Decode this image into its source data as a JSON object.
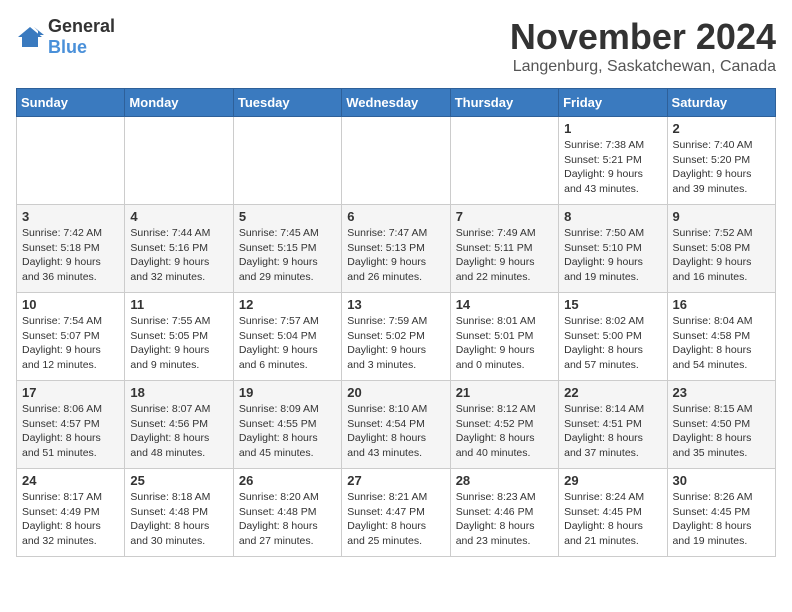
{
  "logo": {
    "general": "General",
    "blue": "Blue"
  },
  "title": "November 2024",
  "location": "Langenburg, Saskatchewan, Canada",
  "days_of_week": [
    "Sunday",
    "Monday",
    "Tuesday",
    "Wednesday",
    "Thursday",
    "Friday",
    "Saturday"
  ],
  "weeks": [
    [
      {
        "day": "",
        "sunrise": "",
        "sunset": "",
        "daylight": ""
      },
      {
        "day": "",
        "sunrise": "",
        "sunset": "",
        "daylight": ""
      },
      {
        "day": "",
        "sunrise": "",
        "sunset": "",
        "daylight": ""
      },
      {
        "day": "",
        "sunrise": "",
        "sunset": "",
        "daylight": ""
      },
      {
        "day": "",
        "sunrise": "",
        "sunset": "",
        "daylight": ""
      },
      {
        "day": "1",
        "sunrise": "Sunrise: 7:38 AM",
        "sunset": "Sunset: 5:21 PM",
        "daylight": "Daylight: 9 hours and 43 minutes."
      },
      {
        "day": "2",
        "sunrise": "Sunrise: 7:40 AM",
        "sunset": "Sunset: 5:20 PM",
        "daylight": "Daylight: 9 hours and 39 minutes."
      }
    ],
    [
      {
        "day": "3",
        "sunrise": "Sunrise: 7:42 AM",
        "sunset": "Sunset: 5:18 PM",
        "daylight": "Daylight: 9 hours and 36 minutes."
      },
      {
        "day": "4",
        "sunrise": "Sunrise: 7:44 AM",
        "sunset": "Sunset: 5:16 PM",
        "daylight": "Daylight: 9 hours and 32 minutes."
      },
      {
        "day": "5",
        "sunrise": "Sunrise: 7:45 AM",
        "sunset": "Sunset: 5:15 PM",
        "daylight": "Daylight: 9 hours and 29 minutes."
      },
      {
        "day": "6",
        "sunrise": "Sunrise: 7:47 AM",
        "sunset": "Sunset: 5:13 PM",
        "daylight": "Daylight: 9 hours and 26 minutes."
      },
      {
        "day": "7",
        "sunrise": "Sunrise: 7:49 AM",
        "sunset": "Sunset: 5:11 PM",
        "daylight": "Daylight: 9 hours and 22 minutes."
      },
      {
        "day": "8",
        "sunrise": "Sunrise: 7:50 AM",
        "sunset": "Sunset: 5:10 PM",
        "daylight": "Daylight: 9 hours and 19 minutes."
      },
      {
        "day": "9",
        "sunrise": "Sunrise: 7:52 AM",
        "sunset": "Sunset: 5:08 PM",
        "daylight": "Daylight: 9 hours and 16 minutes."
      }
    ],
    [
      {
        "day": "10",
        "sunrise": "Sunrise: 7:54 AM",
        "sunset": "Sunset: 5:07 PM",
        "daylight": "Daylight: 9 hours and 12 minutes."
      },
      {
        "day": "11",
        "sunrise": "Sunrise: 7:55 AM",
        "sunset": "Sunset: 5:05 PM",
        "daylight": "Daylight: 9 hours and 9 minutes."
      },
      {
        "day": "12",
        "sunrise": "Sunrise: 7:57 AM",
        "sunset": "Sunset: 5:04 PM",
        "daylight": "Daylight: 9 hours and 6 minutes."
      },
      {
        "day": "13",
        "sunrise": "Sunrise: 7:59 AM",
        "sunset": "Sunset: 5:02 PM",
        "daylight": "Daylight: 9 hours and 3 minutes."
      },
      {
        "day": "14",
        "sunrise": "Sunrise: 8:01 AM",
        "sunset": "Sunset: 5:01 PM",
        "daylight": "Daylight: 9 hours and 0 minutes."
      },
      {
        "day": "15",
        "sunrise": "Sunrise: 8:02 AM",
        "sunset": "Sunset: 5:00 PM",
        "daylight": "Daylight: 8 hours and 57 minutes."
      },
      {
        "day": "16",
        "sunrise": "Sunrise: 8:04 AM",
        "sunset": "Sunset: 4:58 PM",
        "daylight": "Daylight: 8 hours and 54 minutes."
      }
    ],
    [
      {
        "day": "17",
        "sunrise": "Sunrise: 8:06 AM",
        "sunset": "Sunset: 4:57 PM",
        "daylight": "Daylight: 8 hours and 51 minutes."
      },
      {
        "day": "18",
        "sunrise": "Sunrise: 8:07 AM",
        "sunset": "Sunset: 4:56 PM",
        "daylight": "Daylight: 8 hours and 48 minutes."
      },
      {
        "day": "19",
        "sunrise": "Sunrise: 8:09 AM",
        "sunset": "Sunset: 4:55 PM",
        "daylight": "Daylight: 8 hours and 45 minutes."
      },
      {
        "day": "20",
        "sunrise": "Sunrise: 8:10 AM",
        "sunset": "Sunset: 4:54 PM",
        "daylight": "Daylight: 8 hours and 43 minutes."
      },
      {
        "day": "21",
        "sunrise": "Sunrise: 8:12 AM",
        "sunset": "Sunset: 4:52 PM",
        "daylight": "Daylight: 8 hours and 40 minutes."
      },
      {
        "day": "22",
        "sunrise": "Sunrise: 8:14 AM",
        "sunset": "Sunset: 4:51 PM",
        "daylight": "Daylight: 8 hours and 37 minutes."
      },
      {
        "day": "23",
        "sunrise": "Sunrise: 8:15 AM",
        "sunset": "Sunset: 4:50 PM",
        "daylight": "Daylight: 8 hours and 35 minutes."
      }
    ],
    [
      {
        "day": "24",
        "sunrise": "Sunrise: 8:17 AM",
        "sunset": "Sunset: 4:49 PM",
        "daylight": "Daylight: 8 hours and 32 minutes."
      },
      {
        "day": "25",
        "sunrise": "Sunrise: 8:18 AM",
        "sunset": "Sunset: 4:48 PM",
        "daylight": "Daylight: 8 hours and 30 minutes."
      },
      {
        "day": "26",
        "sunrise": "Sunrise: 8:20 AM",
        "sunset": "Sunset: 4:48 PM",
        "daylight": "Daylight: 8 hours and 27 minutes."
      },
      {
        "day": "27",
        "sunrise": "Sunrise: 8:21 AM",
        "sunset": "Sunset: 4:47 PM",
        "daylight": "Daylight: 8 hours and 25 minutes."
      },
      {
        "day": "28",
        "sunrise": "Sunrise: 8:23 AM",
        "sunset": "Sunset: 4:46 PM",
        "daylight": "Daylight: 8 hours and 23 minutes."
      },
      {
        "day": "29",
        "sunrise": "Sunrise: 8:24 AM",
        "sunset": "Sunset: 4:45 PM",
        "daylight": "Daylight: 8 hours and 21 minutes."
      },
      {
        "day": "30",
        "sunrise": "Sunrise: 8:26 AM",
        "sunset": "Sunset: 4:45 PM",
        "daylight": "Daylight: 8 hours and 19 minutes."
      }
    ]
  ]
}
